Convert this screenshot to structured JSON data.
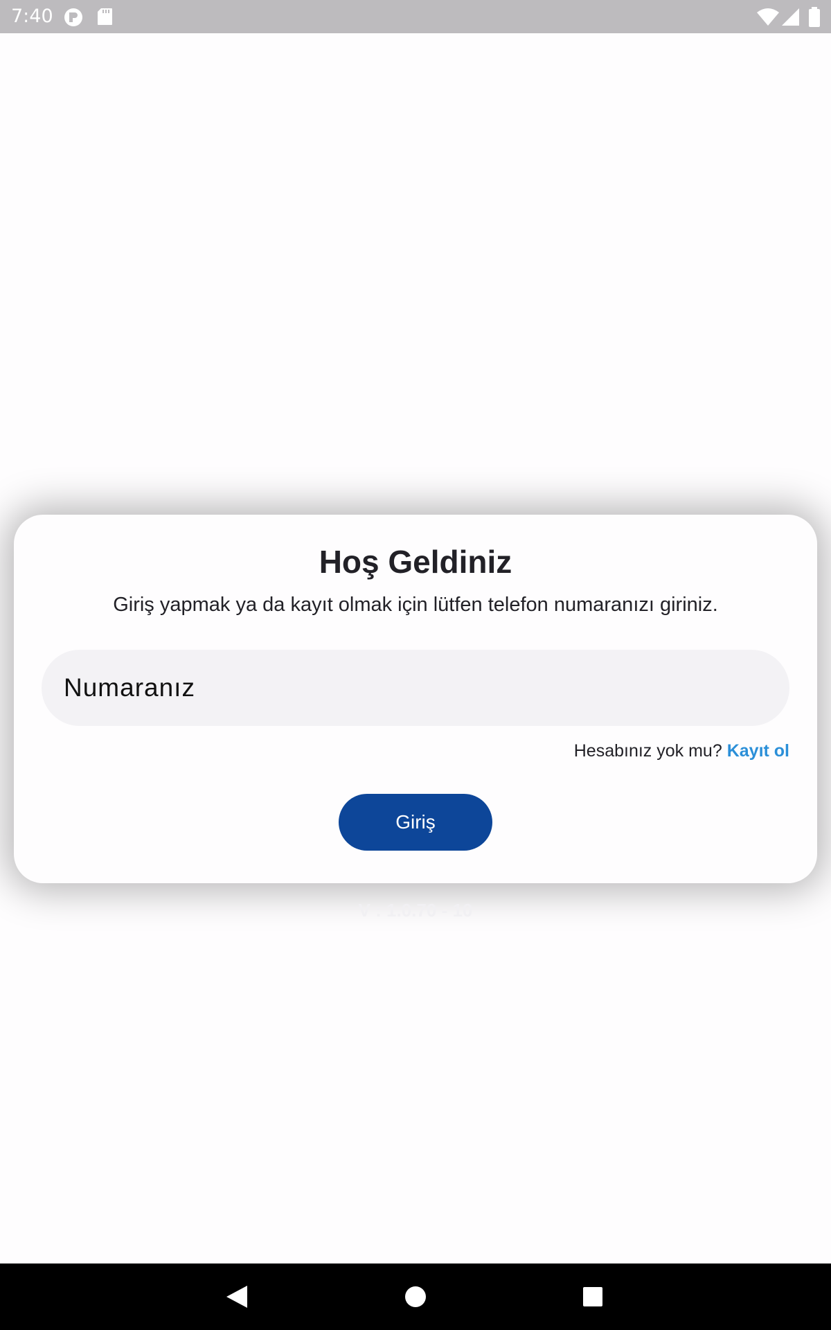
{
  "status_bar": {
    "time": "7:40",
    "icons": [
      "app-notification-icon",
      "sd-card-icon",
      "wifi-icon",
      "cell-signal-icon",
      "battery-icon"
    ]
  },
  "login_card": {
    "title": "Hoş Geldiniz",
    "subtitle": "Giriş yapmak ya da kayıt olmak için lütfen telefon numaranızı giriniz.",
    "phone_field": {
      "placeholder": "Numaranız",
      "value": ""
    },
    "signup_prompt": "Hesabınız yok mu?",
    "signup_link": "Kayıt ol",
    "login_button": "Giriş"
  },
  "version": "V : 1.0.70 - 10",
  "colors": {
    "status_bar": "#bdbbbe",
    "background": "#fefdfe",
    "input_fill": "#f3f2f5",
    "primary_button": "#0d4699",
    "link": "#2b8fd8",
    "text": "#222127",
    "nav_bar": "#000000"
  },
  "nav_bar": {
    "buttons": [
      "back-icon",
      "home-icon",
      "recents-icon"
    ]
  }
}
